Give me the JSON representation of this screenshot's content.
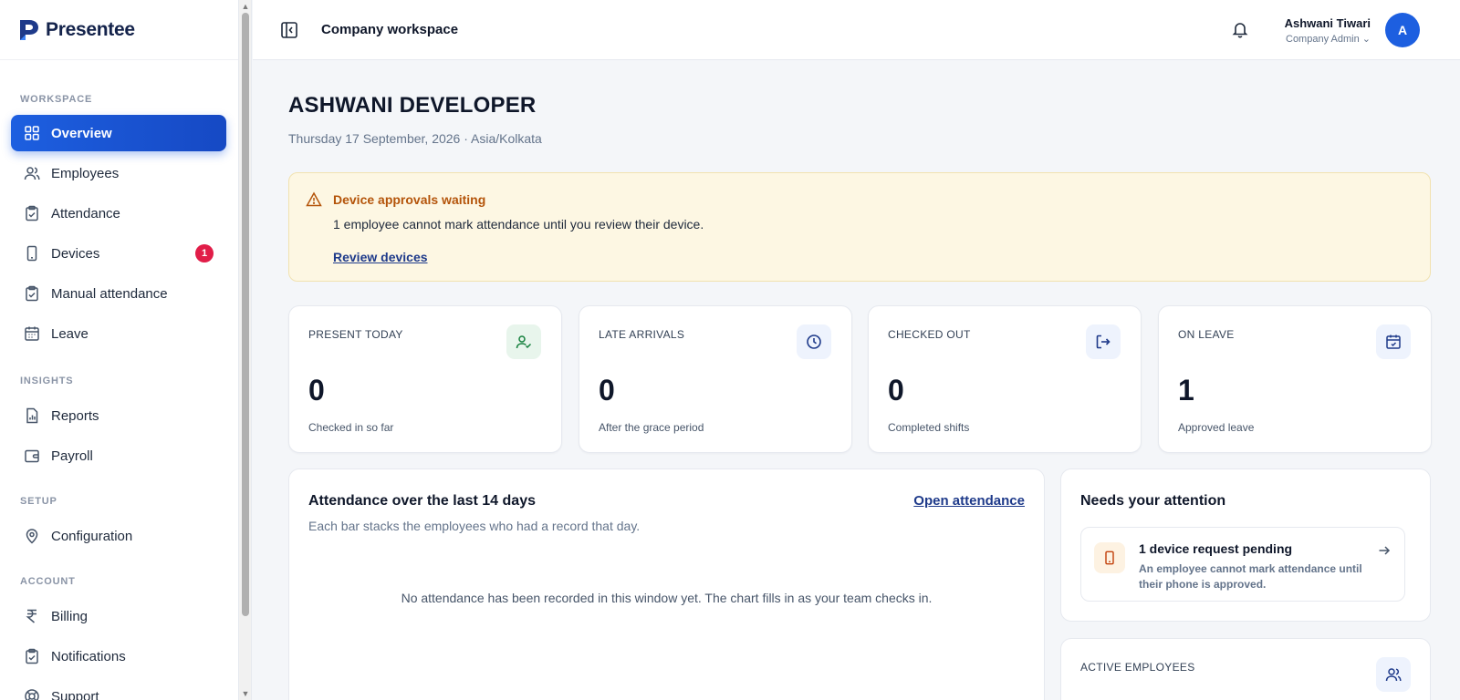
{
  "app": {
    "name": "Presentee"
  },
  "sidebar": {
    "sections": {
      "workspace": "WORKSPACE",
      "insights": "INSIGHTS",
      "setup": "SETUP",
      "account": "ACCOUNT"
    },
    "items": [
      {
        "label": "Overview",
        "icon": "grid-icon",
        "active": true
      },
      {
        "label": "Employees",
        "icon": "users-icon"
      },
      {
        "label": "Attendance",
        "icon": "clipboard-check-icon"
      },
      {
        "label": "Devices",
        "icon": "smartphone-icon",
        "badge": "1"
      },
      {
        "label": "Manual attendance",
        "icon": "clipboard-check-icon"
      },
      {
        "label": "Leave",
        "icon": "calendar-icon"
      },
      {
        "label": "Reports",
        "icon": "report-icon"
      },
      {
        "label": "Payroll",
        "icon": "wallet-icon"
      },
      {
        "label": "Configuration",
        "icon": "map-pin-icon"
      },
      {
        "label": "Billing",
        "icon": "rupee-icon"
      },
      {
        "label": "Notifications",
        "icon": "clipboard-check-icon"
      },
      {
        "label": "Support",
        "icon": "life-buoy-icon"
      }
    ]
  },
  "header": {
    "title": "Company workspace",
    "user_name": "Ashwani Tiwari",
    "user_role": "Company Admin",
    "avatar_initial": "A"
  },
  "page": {
    "title": "ASHWANI DEVELOPER",
    "date": "Thursday 17 September, 2026 · Asia/Kolkata"
  },
  "alert": {
    "title": "Device approvals waiting",
    "text": "1 employee cannot mark attendance until you review their device.",
    "link": "Review devices"
  },
  "stats": [
    {
      "label": "PRESENT TODAY",
      "value": "0",
      "sub": "Checked in so far",
      "icon": "user-check-icon",
      "icon_bg": "#e8f5ec",
      "icon_color": "#15803d"
    },
    {
      "label": "LATE ARRIVALS",
      "value": "0",
      "sub": "After the grace period",
      "icon": "clock-icon",
      "icon_bg": "#eef3fd",
      "icon_color": "#1e3a8a"
    },
    {
      "label": "CHECKED OUT",
      "value": "0",
      "sub": "Completed shifts",
      "icon": "log-out-icon",
      "icon_bg": "#eef3fd",
      "icon_color": "#1e3a8a"
    },
    {
      "label": "ON LEAVE",
      "value": "1",
      "sub": "Approved leave",
      "icon": "calendar-check-icon",
      "icon_bg": "#eef3fd",
      "icon_color": "#1e3a8a"
    }
  ],
  "attendance_panel": {
    "title": "Attendance over the last 14 days",
    "subtitle": "Each bar stacks the employees who had a record that day.",
    "link": "Open attendance",
    "empty": "No attendance has been recorded in this window yet. The chart fills in as your team checks in."
  },
  "attention_panel": {
    "title": "Needs your attention",
    "request_title": "1 device request pending",
    "request_desc": "An employee cannot mark attendance until their phone is approved."
  },
  "active_employees": {
    "label": "ACTIVE EMPLOYEES"
  },
  "colors": {
    "accent": "#1d5fe0",
    "badge": "#e11d48",
    "warning": "#b4540a"
  }
}
